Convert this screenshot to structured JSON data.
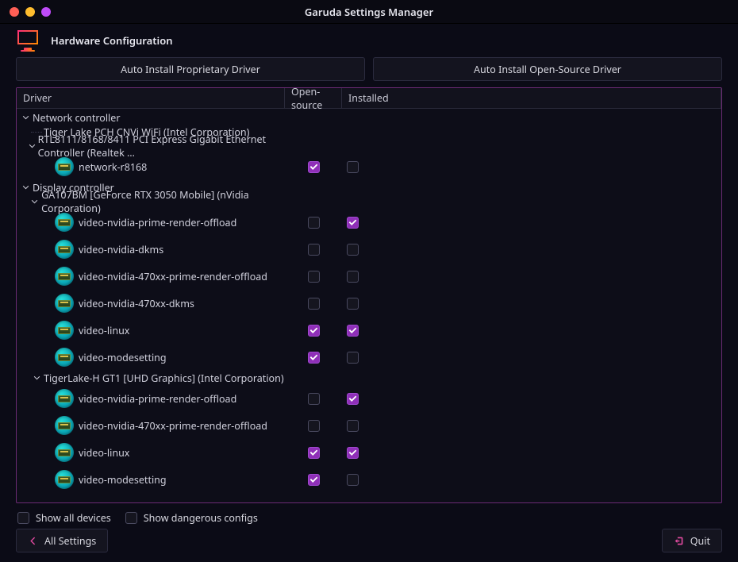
{
  "window": {
    "title": "Garuda Settings Manager"
  },
  "header": {
    "title": "Hardware Configuration"
  },
  "topButtons": {
    "proprietary": "Auto Install Proprietary Driver",
    "opensource": "Auto Install Open-Source Driver"
  },
  "treeHeader": {
    "driver": "Driver",
    "opensource": "Open-source",
    "installed": "Installed"
  },
  "tree": [
    {
      "label": "Network controller",
      "devices": [
        {
          "label": "Tiger Lake PCH CNVi WiFi (Intel Corporation)",
          "drivers": []
        },
        {
          "label": "RTL8111/8168/8411 PCI Express Gigabit Ethernet Controller (Realtek …",
          "drivers": [
            {
              "name": "network-r8168",
              "opensource": true,
              "installed": false
            }
          ]
        }
      ]
    },
    {
      "label": "Display controller",
      "devices": [
        {
          "label": "GA107BM [GeForce RTX 3050 Mobile] (nVidia Corporation)",
          "drivers": [
            {
              "name": "video-nvidia-prime-render-offload",
              "opensource": false,
              "installed": true
            },
            {
              "name": "video-nvidia-dkms",
              "opensource": false,
              "installed": false
            },
            {
              "name": "video-nvidia-470xx-prime-render-offload",
              "opensource": false,
              "installed": false
            },
            {
              "name": "video-nvidia-470xx-dkms",
              "opensource": false,
              "installed": false
            },
            {
              "name": "video-linux",
              "opensource": true,
              "installed": true
            },
            {
              "name": "video-modesetting",
              "opensource": true,
              "installed": false
            }
          ]
        },
        {
          "label": "TigerLake-H GT1 [UHD Graphics] (Intel Corporation)",
          "drivers": [
            {
              "name": "video-nvidia-prime-render-offload",
              "opensource": false,
              "installed": true
            },
            {
              "name": "video-nvidia-470xx-prime-render-offload",
              "opensource": false,
              "installed": false
            },
            {
              "name": "video-linux",
              "opensource": true,
              "installed": true
            },
            {
              "name": "video-modesetting",
              "opensource": true,
              "installed": false
            }
          ]
        }
      ]
    }
  ],
  "options": {
    "showAll": {
      "label": "Show all devices",
      "checked": false
    },
    "showDangerous": {
      "label": "Show dangerous configs",
      "checked": false
    }
  },
  "footer": {
    "allSettings": "All Settings",
    "quit": "Quit"
  }
}
